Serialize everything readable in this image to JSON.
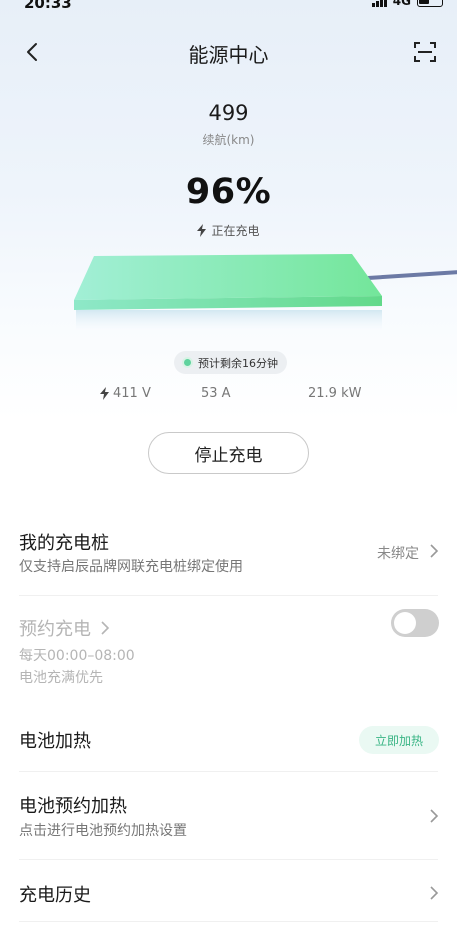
{
  "status_bar": {
    "time": "20:33",
    "network": "4G"
  },
  "header": {
    "title": "能源中心"
  },
  "range": {
    "value": "499",
    "label": "续航(km)"
  },
  "battery": {
    "soc": "96%",
    "state": "正在充电"
  },
  "eta": {
    "text": "预计剩余16分钟"
  },
  "metrics": {
    "voltage": "411 V",
    "current": "53 A",
    "power": "21.9 kW"
  },
  "actions": {
    "stop_label": "停止充电"
  },
  "rows": {
    "my_charger": {
      "title": "我的充电桩",
      "subtitle": "仅支持启辰品牌网联充电桩绑定使用",
      "status": "未绑定"
    },
    "scheduled_charge": {
      "title": "预约充电",
      "time": "每天00:00–08:00",
      "mode": "电池充满优先",
      "enabled": false
    },
    "battery_heat": {
      "title": "电池加热",
      "button": "立即加热"
    },
    "scheduled_heat": {
      "title": "电池预约加热",
      "subtitle": "点击进行电池预约加热设置"
    },
    "history": {
      "title": "充电历史"
    }
  },
  "colors": {
    "accent_green": "#5fd39e",
    "pad_green": "#7ee8a8",
    "cable": "#6c7aa5"
  }
}
